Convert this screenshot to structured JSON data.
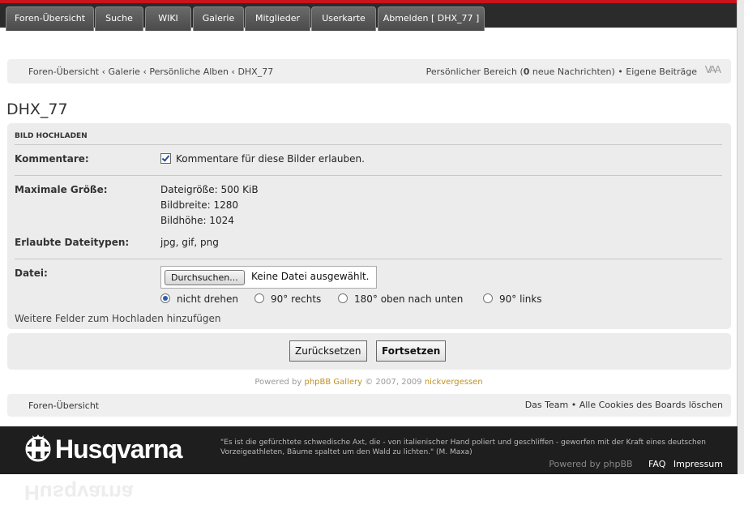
{
  "nav": {
    "tabs": [
      "Foren-Übersicht",
      "Suche",
      "WIKI",
      "Galerie",
      "Mitglieder",
      "Userkarte",
      "Abmelden [ DHX_77 ]"
    ]
  },
  "breadcrumb": {
    "items": [
      "Foren-Übersicht",
      "Galerie",
      "Persönliche Alben",
      "DHX_77"
    ],
    "sep": "‹"
  },
  "user_links": {
    "personal": "Persönlicher Bereich",
    "open": "(",
    "count": "0",
    "messages": "neue Nachrichten)",
    "bullet": "•",
    "own_posts": "Eigene Beiträge",
    "font_size": "VAA"
  },
  "page": {
    "title": "DHX_77"
  },
  "upload": {
    "heading": "BILD HOCHLADEN",
    "comments_label": "Kommentare:",
    "comments_checkbox": "Kommentare für diese Bilder erlauben.",
    "comments_checked": true,
    "maxsize_label": "Maximale Größe:",
    "filesize": "Dateigröße: 500 KiB",
    "width": "Bildbreite: 1280",
    "height": "Bildhöhe: 1024",
    "types_label": "Erlaubte Dateitypen:",
    "types": "jpg, gif, png",
    "file_label": "Datei:",
    "browse_button": "Durchsuchen...",
    "no_file": "Keine Datei ausgewählt.",
    "rotate": [
      {
        "label": "nicht drehen",
        "selected": true
      },
      {
        "label": "90° rechts",
        "selected": false
      },
      {
        "label": "180° oben nach unten",
        "selected": false
      },
      {
        "label": "90° links",
        "selected": false
      }
    ],
    "more_fields": "Weitere Felder zum Hochladen hinzufügen"
  },
  "buttons": {
    "reset": "Zurücksetzen",
    "continue": "Fortsetzen"
  },
  "credit": {
    "powered": "Powered by",
    "gallery": "phpBB Gallery",
    "copy": "© 2007, 2009",
    "author": "nickvergessen"
  },
  "footnav": {
    "left": "Foren-Übersicht",
    "team": "Das Team",
    "bullet": "•",
    "cookies": "Alle Cookies des Boards löschen"
  },
  "footer": {
    "logo": "Husqvarna",
    "quote": "\"Es ist die gefürchtete schwedische Axt, die - von italienischer Hand poliert und geschliffen - geworfen mit der Kraft eines deutschen Vorzeigeathleten, Bäume spaltet um den Wald zu lichten.\" (M. Maxa)",
    "powered": "Powered by phpBB",
    "faq": "FAQ",
    "impressum": "Impressum"
  },
  "colors": {
    "topbar_red": "#c8141a",
    "link_gold": "#c09020",
    "footer_bg": "#1e1e1e"
  }
}
